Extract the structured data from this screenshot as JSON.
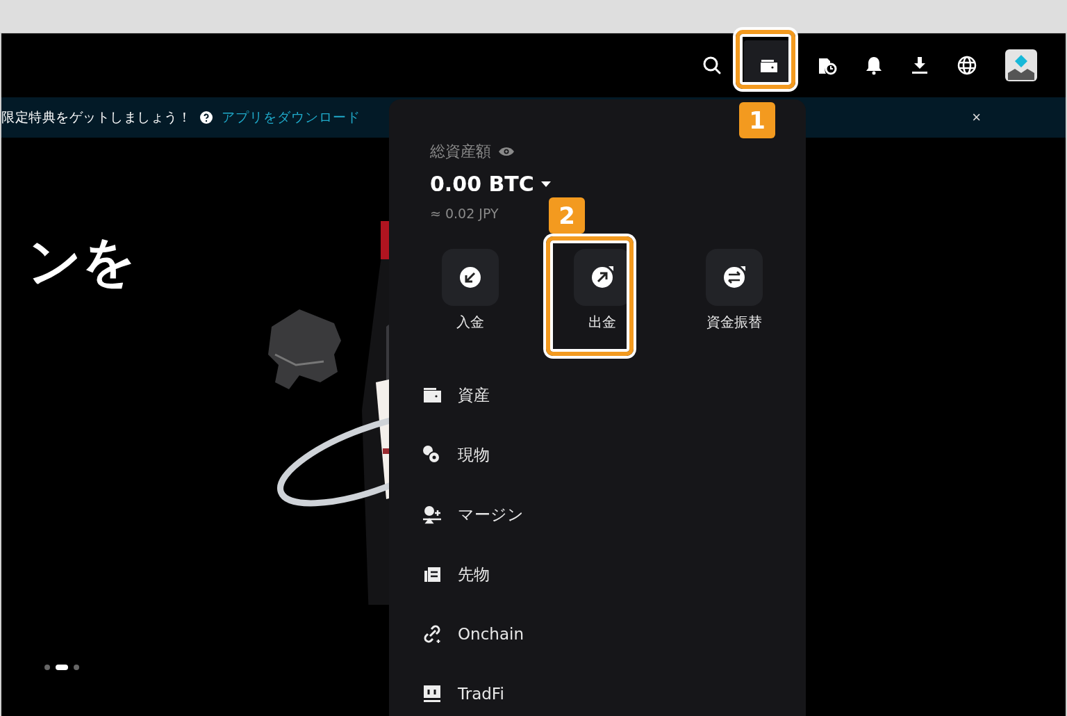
{
  "toolbar": {
    "wallet_selected": true
  },
  "banner": {
    "message": "限定特典をゲットしましょう！",
    "link": "アプリをダウンロード",
    "close": "×"
  },
  "hero": {
    "heading": "ンを",
    "dots": [
      {
        "selected": false
      },
      {
        "selected": true
      },
      {
        "selected": false
      }
    ]
  },
  "assets_menu": {
    "total_label": "総資産額",
    "amount": "0.00 BTC",
    "converted": "≈ 0.02 JPY",
    "actions": [
      {
        "kind": "deposit",
        "label": "入金"
      },
      {
        "kind": "withdraw",
        "label": "出金"
      },
      {
        "kind": "transfer",
        "label": "資金振替"
      }
    ],
    "items": [
      {
        "kind": "wallet",
        "label": "資産"
      },
      {
        "kind": "spot",
        "label": "現物"
      },
      {
        "kind": "margin",
        "label": "マージン"
      },
      {
        "kind": "futures",
        "label": "先物"
      },
      {
        "kind": "onchain",
        "label": "Onchain"
      },
      {
        "kind": "tradfi",
        "label": "TradFi"
      }
    ]
  },
  "callouts": [
    {
      "number": "1"
    },
    {
      "number": "2"
    }
  ]
}
